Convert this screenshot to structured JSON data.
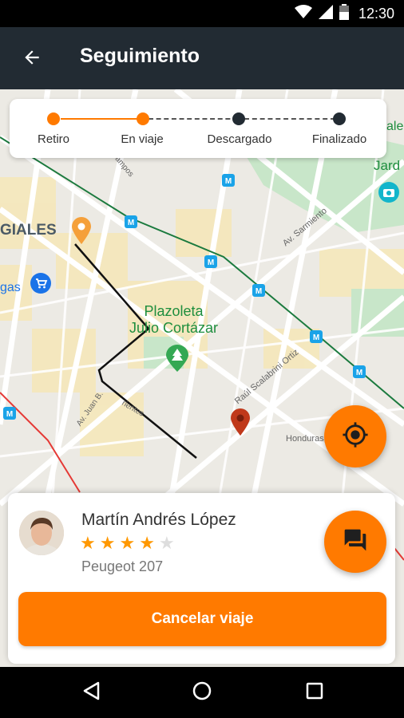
{
  "status_bar": {
    "time": "12:30"
  },
  "app_bar": {
    "title": "Seguimiento"
  },
  "map": {
    "labels": {
      "neighborhood": "GIALES",
      "plaza": "Plazoleta\nJulio Cortázar",
      "shop": "gas",
      "park_top": "alea",
      "garden": "Jard",
      "street_sarmiento": "Av. Sarmiento",
      "street_scalabrini": "Raúl Scalabrini Ortiz",
      "street_juan_b": "Av. Juan B.",
      "street_honduras": "Honduras",
      "street_campos": "ampos",
      "street_corrientes": "rientes"
    }
  },
  "progress": {
    "steps": [
      {
        "label": "Retiro",
        "done": true
      },
      {
        "label": "En viaje",
        "done": true
      },
      {
        "label": "Descargado",
        "done": false
      },
      {
        "label": "Finalizado",
        "done": false
      }
    ]
  },
  "driver": {
    "name": "Martín Andrés López",
    "rating": 4,
    "rating_max": 5,
    "vehicle": "Peugeot 207"
  },
  "actions": {
    "cancel_label": "Cancelar viaje"
  },
  "colors": {
    "accent": "#ff7a00",
    "app_bar": "#222b33",
    "route": "#111111"
  },
  "icons": {
    "back": "arrow-back-icon",
    "locate": "my-location-icon",
    "chat": "chat-icon",
    "pickup_pin": "orange-pin-icon",
    "dest_pin": "red-pin-icon",
    "park": "tree-icon",
    "subway": "subway-icon"
  }
}
